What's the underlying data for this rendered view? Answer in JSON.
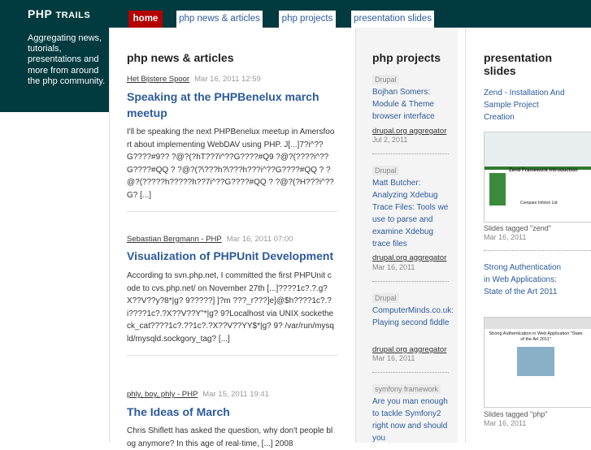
{
  "brand": {
    "title_main": "PHP ",
    "title_small": "TRAILS",
    "description": "Aggregating news, tutorials, presentations and more from around the php community."
  },
  "nav": {
    "tabs": [
      {
        "label": "home",
        "active": true
      },
      {
        "label": "php news & articles",
        "active": false
      },
      {
        "label": "php projects",
        "active": false
      },
      {
        "label": "presentation slides",
        "active": false
      }
    ]
  },
  "news": {
    "heading": "php news & articles",
    "articles": [
      {
        "source": "Het Bijstere Spoor",
        "date": "Mar 16, 2011 12:59",
        "title": "Speaking at the PHPBenelux march meetup",
        "body": "I'll be speaking the next PHPBenelux meetup in Amersfoort about implementing WebDAV using PHP. J[...]7?i^??G????#9?? ?@?(?hT??7i^??G????#Q9 ?@?(????i^??G????#QQ ? ?@?(?\\???h?\\???h???i^??G????#QQ ? ?@?(?????h?????h??7i^??G????#QQ ? ?@?(?H???i^??G? [...]"
      },
      {
        "source": "Sebastian Bergmann - PHP",
        "date": "Mar 16, 2011 07:00",
        "title": "Visualization of PHPUnit Development",
        "body": "According to svn.php.net, I committed the first PHPUnit code to cvs.php.net/ on November 27th [...]????1c?.?.g?X??V??y?8*|g? 9?????] ]?m ???_r???]e]@$h????1c?.?i????1c?.?X??V??Y\"*|g? 9?Localhost via UNIX socketheck_cat????1c?.??1c?.?X??V??YY$*|g? 9? /var/run/mysqld/mysqld.sockgory_tag? [...]"
      },
      {
        "source": "phly, boy, phly - PHP",
        "date": "Mar 15, 2011 19:41",
        "title": "The Ideas of March",
        "body": "Chris Shiflett has asked the question, why don't people blog anymore? In this age of real-time, [...] 2008"
      }
    ]
  },
  "projects": {
    "heading": "php projects",
    "items": [
      {
        "category": "Drupal",
        "title": "Bojhan Somers: Module & Theme browser interface",
        "source": "drupal.org aggregator",
        "date": "Jul 2, 2011"
      },
      {
        "category": "Drupal",
        "title": "Matt Butcher: Analyzing Xdebug Trace Files: Tools we use to parse and examine Xdebug trace files",
        "source": "drupal.org aggregator",
        "date": "Mar 16, 2011"
      },
      {
        "category": "Drupal",
        "title": "ComputerMinds.co.uk: Playing second fiddle",
        "source": "drupal.org aggregator",
        "date": "Mar 16, 2011"
      },
      {
        "category": "symfony framework",
        "title": "Are you man enough to tackle Symfony2 right now and should you",
        "source": "",
        "date": ""
      }
    ]
  },
  "slides": {
    "heading": "presentation slides",
    "items": [
      {
        "title": "Zend - Installation And Sample Project Creation",
        "thumb_title": "Zend Framework Introduction",
        "thumb_sub": "Compare Infoton Ltd",
        "caption": "Slides tagged \"zend\"",
        "date": "Mar 16, 2011"
      },
      {
        "title": "Strong Authentication in Web Applications: State of the Art 2011",
        "thumb_title": "Strong Authentication in Web Application \"State of the Art 2011\"",
        "thumb_sub": "",
        "caption": "Slides tagged \"php\"",
        "date": "Mar 16, 2011"
      }
    ]
  },
  "colors": {
    "brand_bg": "#013a3f",
    "link": "#2c5a9c",
    "active_tab": "#b30000"
  }
}
